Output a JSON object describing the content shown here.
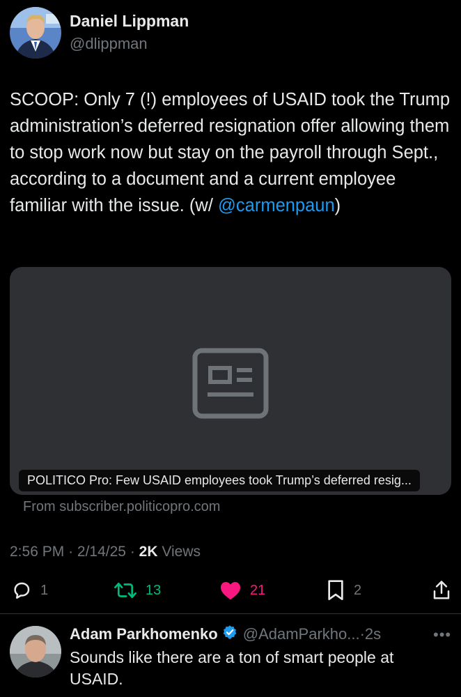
{
  "tweet": {
    "author_name": "Daniel Lippman",
    "author_handle": "@dlippman",
    "text_before": "SCOOP: Only 7 (!) employees of USAID took the Trump administration’s deferred resignation offer allowing them to stop work now but stay on the payroll through Sept., according to a document and a current employee familiar with the issue. (w/ ",
    "mention": "@carmenpaun",
    "text_after": ")",
    "card": {
      "caption": "POLITICO Pro: Few USAID employees took Trump’s deferred resig...",
      "source": "From subscriber.politicopro.com",
      "icon": "article-placeholder-icon"
    },
    "time": "2:56 PM",
    "date": "2/14/25",
    "views_count": "2K",
    "views_label": "Views",
    "separator": "·",
    "actions": {
      "replies": "1",
      "retweets": "13",
      "likes": "21",
      "bookmarks": "2"
    },
    "colors": {
      "background": "#000000",
      "text": "#e7e9ea",
      "muted": "#71767b",
      "link": "#1d9bf0",
      "retweet": "#00ba7c",
      "like": "#f91880",
      "card": "#2f3033"
    }
  },
  "reply": {
    "author_name": "Adam Parkhomenko",
    "author_handle": "@AdamParkho...",
    "separator": "·",
    "time": "2s",
    "verified_icon": "verified-badge-icon",
    "text": "Sounds like there are a ton of smart people at USAID."
  }
}
